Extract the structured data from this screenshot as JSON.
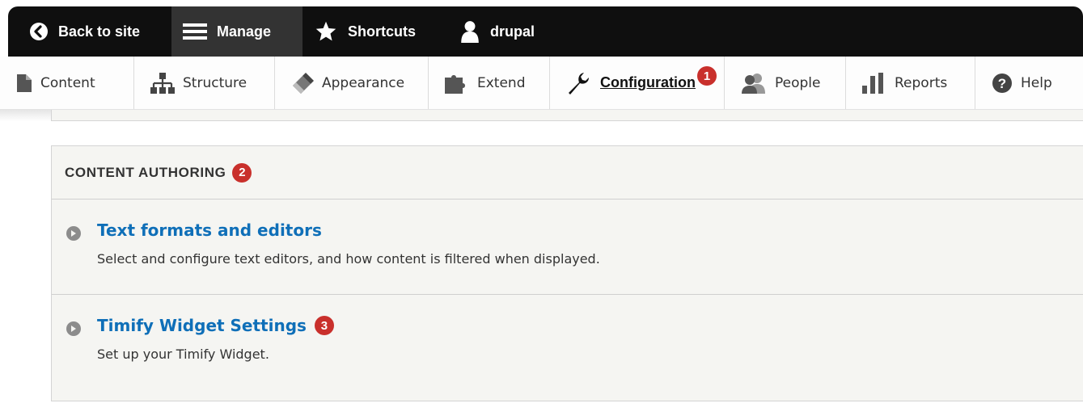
{
  "toolbar": {
    "items": [
      {
        "label": "Back to site",
        "icon": "back-arrow-icon"
      },
      {
        "label": "Manage",
        "icon": "hamburger-menu-icon",
        "active": true
      },
      {
        "label": "Shortcuts",
        "icon": "star-icon"
      },
      {
        "label": "drupal",
        "icon": "user-icon"
      }
    ]
  },
  "tray": {
    "items": [
      {
        "label": "Content",
        "icon": "file-icon"
      },
      {
        "label": "Structure",
        "icon": "sitemap-icon"
      },
      {
        "label": "Appearance",
        "icon": "paintbrush-icon"
      },
      {
        "label": "Extend",
        "icon": "puzzle-icon"
      },
      {
        "label": "Configuration",
        "icon": "wrench-icon",
        "current": true,
        "badge": "1"
      },
      {
        "label": "People",
        "icon": "people-icon"
      },
      {
        "label": "Reports",
        "icon": "bar-chart-icon"
      },
      {
        "label": "Help",
        "icon": "help-icon"
      }
    ]
  },
  "section": {
    "title": "CONTENT AUTHORING",
    "badge": "2",
    "entries": [
      {
        "title": "Text formats and editors",
        "description": "Select and configure text editors, and how content is filtered when displayed."
      },
      {
        "title": "Timify Widget Settings",
        "badge": "3",
        "description": "Set up your Timify Widget."
      }
    ]
  },
  "colors": {
    "toolbar_bg": "#0f0f0f",
    "toolbar_active": "#333333",
    "link": "#0f6fb8",
    "badge": "#c9302c",
    "panel_bg": "#f5f5f2"
  }
}
